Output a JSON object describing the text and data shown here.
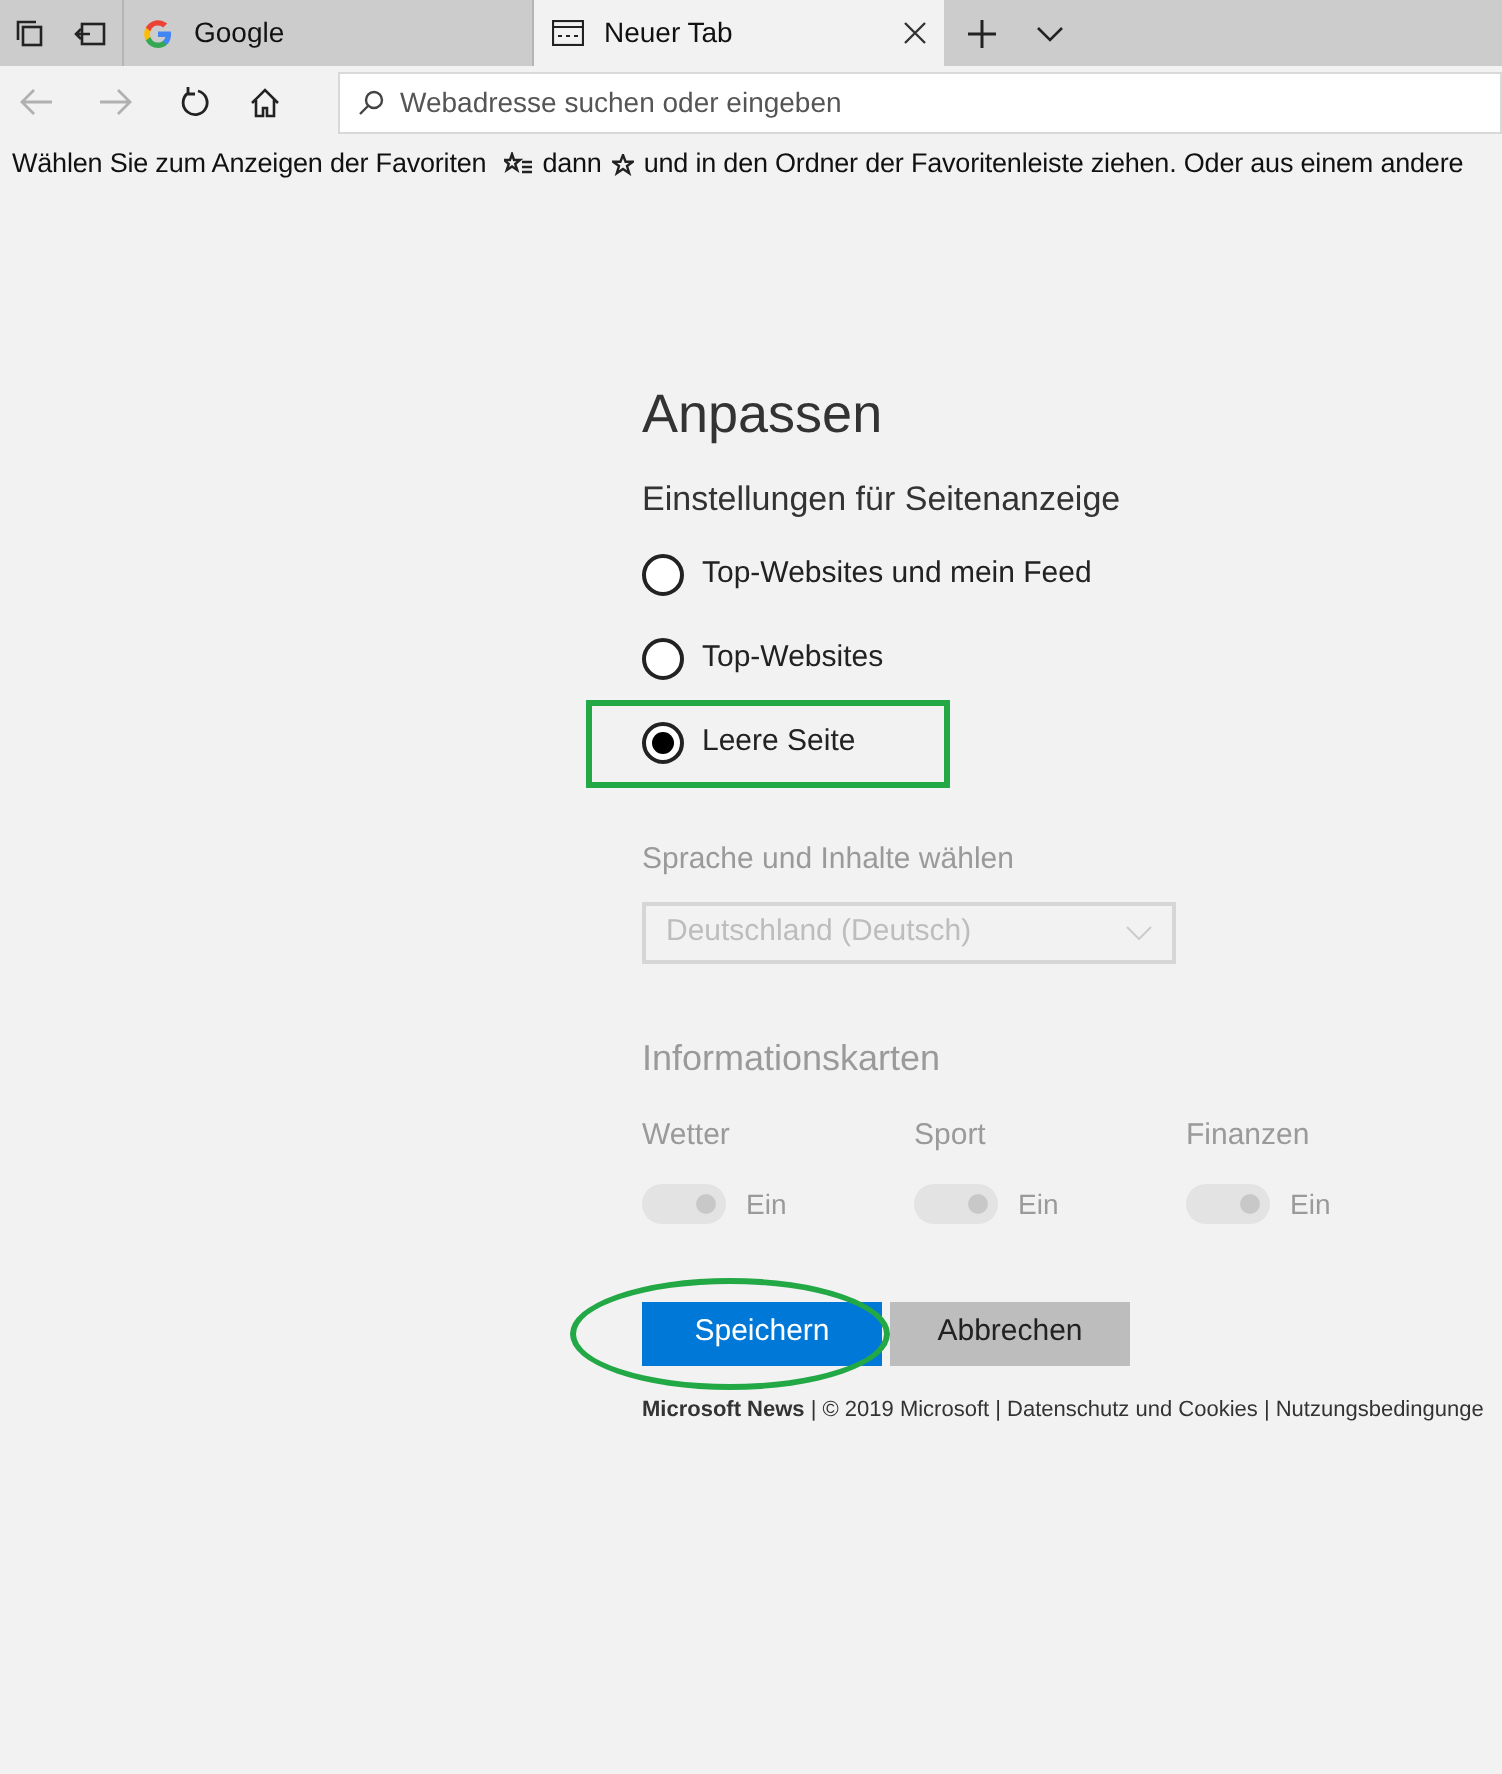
{
  "tabs": [
    {
      "kind": "site",
      "label": "Google",
      "selected": false
    },
    {
      "kind": "newtab",
      "label": "Neuer Tab",
      "selected": true
    }
  ],
  "address_bar": {
    "placeholder": "Webadresse suchen oder eingeben"
  },
  "favorites_bar": {
    "text_before": "Wählen Sie zum Anzeigen der Favoriten",
    "text_middle": "dann",
    "text_after": "und in den Ordner der Favoritenleiste ziehen. Oder aus einem andere"
  },
  "panel": {
    "title": "Anpassen",
    "subtitle": "Einstellungen für Seitenanzeige",
    "options": [
      {
        "label": "Top-Websites und mein Feed",
        "selected": false
      },
      {
        "label": "Top-Websites",
        "selected": false
      },
      {
        "label": "Leere Seite",
        "selected": true
      }
    ],
    "language": {
      "label": "Sprache und Inhalte wählen",
      "value": "Deutschland (Deutsch)",
      "disabled": true
    },
    "info_cards": {
      "title": "Informationskarten",
      "disabled": true,
      "items": [
        {
          "label": "Wetter",
          "on": true,
          "state_label": "Ein"
        },
        {
          "label": "Sport",
          "on": true,
          "state_label": "Ein"
        },
        {
          "label": "Finanzen",
          "on": true,
          "state_label": "Ein"
        }
      ]
    },
    "buttons": [
      {
        "kind": "primary",
        "label": "Speichern"
      },
      {
        "kind": "secondary",
        "label": "Abbrechen"
      }
    ],
    "footer": "**Microsoft News** | © 2019 Microsoft | Datenschutz und Cookies | Nutzungsbedingunge"
  },
  "annotations": [
    {
      "kind": "rectangle"
    },
    {
      "kind": "ellipse"
    }
  ]
}
